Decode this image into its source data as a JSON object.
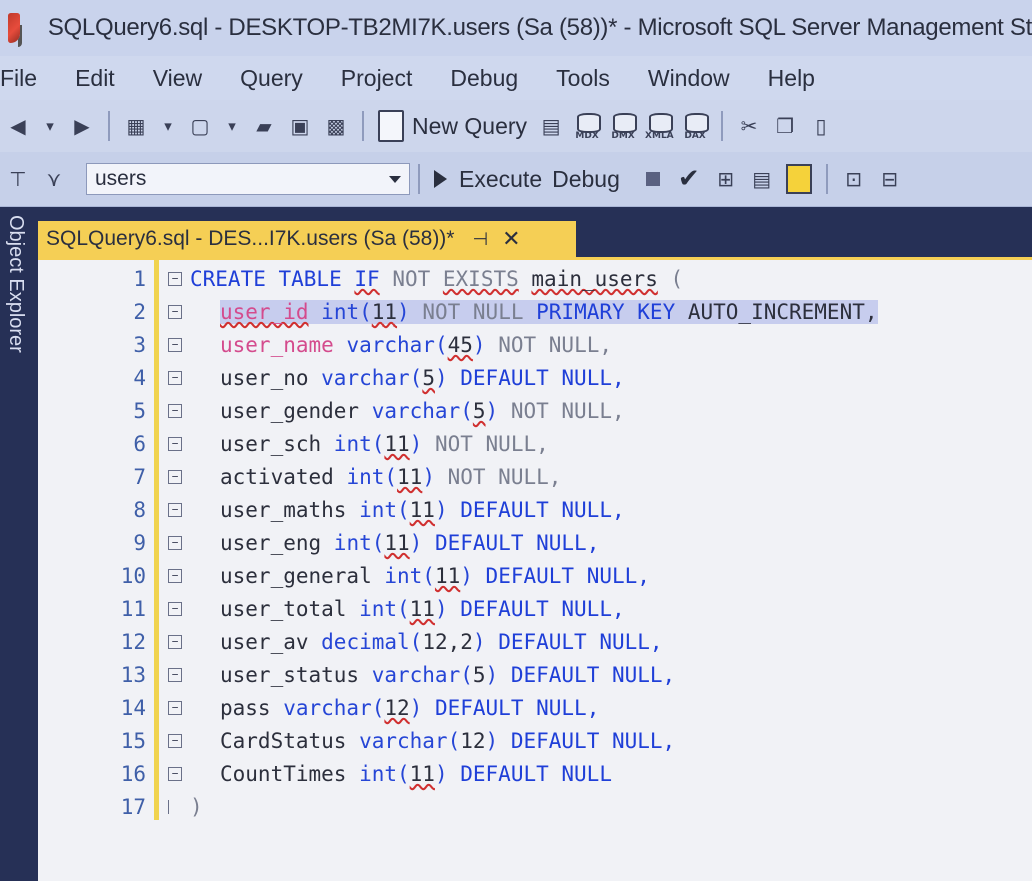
{
  "title_bar": {
    "title": "SQLQuery6.sql - DESKTOP-TB2MI7K.users (Sa (58))* - Microsoft SQL Server Management St"
  },
  "menu": [
    "File",
    "Edit",
    "View",
    "Query",
    "Project",
    "Debug",
    "Tools",
    "Window",
    "Help"
  ],
  "toolbar": {
    "new_query_label": "New Query",
    "db_icon_tags": [
      "MDX",
      "DMX",
      "XMLA",
      "DAX"
    ]
  },
  "toolbar2": {
    "database": "users",
    "execute_label": "Execute",
    "debug_label": "Debug"
  },
  "side_panel": {
    "label": "Object Explorer"
  },
  "document_tab": {
    "title": "SQLQuery6.sql - DES...I7K.users (Sa (58))*"
  },
  "editor": {
    "line_numbers": [
      "1",
      "2",
      "3",
      "4",
      "5",
      "6",
      "7",
      "8",
      "9",
      "10",
      "11",
      "12",
      "13",
      "14",
      "15",
      "16",
      "17"
    ],
    "lines": [
      [
        {
          "t": "CREATE TABLE ",
          "c": "kw"
        },
        {
          "t": "IF",
          "c": "kw squig"
        },
        {
          "t": " NOT ",
          "c": "gr"
        },
        {
          "t": "EXISTS",
          "c": "gr squig"
        },
        {
          "t": " ",
          "c": "id"
        },
        {
          "t": "main_users",
          "c": "id squig"
        },
        {
          "t": " (",
          "c": "gr"
        }
      ],
      [
        {
          "t": "user_id",
          "c": "pink squig"
        },
        {
          "t": " ",
          "c": "id"
        },
        {
          "t": "int(",
          "c": "tp"
        },
        {
          "t": "11",
          "c": "id squig"
        },
        {
          "t": ")",
          "c": "tp"
        },
        {
          "t": " NOT NULL ",
          "c": "gr"
        },
        {
          "t": "PRIMARY KEY",
          "c": "pk"
        },
        {
          "t": " AUTO_INCREMENT,",
          "c": "id"
        }
      ],
      [
        {
          "t": "user_name",
          "c": "pink"
        },
        {
          "t": " ",
          "c": "id"
        },
        {
          "t": "varchar(",
          "c": "tp"
        },
        {
          "t": "45",
          "c": "id squig"
        },
        {
          "t": ")",
          "c": "tp"
        },
        {
          "t": " NOT NULL,",
          "c": "gr"
        }
      ],
      [
        {
          "t": "user_no ",
          "c": "id"
        },
        {
          "t": "varchar(",
          "c": "tp"
        },
        {
          "t": "5",
          "c": "id squig"
        },
        {
          "t": ")",
          "c": "tp"
        },
        {
          "t": " DEFAULT NULL,",
          "c": "kw"
        }
      ],
      [
        {
          "t": "user_gender ",
          "c": "id"
        },
        {
          "t": "varchar(",
          "c": "tp"
        },
        {
          "t": "5",
          "c": "id squig"
        },
        {
          "t": ")",
          "c": "tp"
        },
        {
          "t": " NOT NULL,",
          "c": "gr"
        }
      ],
      [
        {
          "t": "user_sch ",
          "c": "id"
        },
        {
          "t": "int(",
          "c": "tp"
        },
        {
          "t": "11",
          "c": "id squig"
        },
        {
          "t": ")",
          "c": "tp"
        },
        {
          "t": " NOT NULL,",
          "c": "gr"
        }
      ],
      [
        {
          "t": "activated ",
          "c": "id"
        },
        {
          "t": "int(",
          "c": "tp"
        },
        {
          "t": "11",
          "c": "id squig"
        },
        {
          "t": ")",
          "c": "tp"
        },
        {
          "t": " NOT NULL,",
          "c": "gr"
        }
      ],
      [
        {
          "t": "user_maths ",
          "c": "id"
        },
        {
          "t": "int(",
          "c": "tp"
        },
        {
          "t": "11",
          "c": "id squig"
        },
        {
          "t": ")",
          "c": "tp"
        },
        {
          "t": " DEFAULT NULL,",
          "c": "kw"
        }
      ],
      [
        {
          "t": "user_eng ",
          "c": "id"
        },
        {
          "t": "int(",
          "c": "tp"
        },
        {
          "t": "11",
          "c": "id squig"
        },
        {
          "t": ")",
          "c": "tp"
        },
        {
          "t": " DEFAULT NULL,",
          "c": "kw"
        }
      ],
      [
        {
          "t": "user_general ",
          "c": "id"
        },
        {
          "t": "int(",
          "c": "tp"
        },
        {
          "t": "11",
          "c": "id squig"
        },
        {
          "t": ")",
          "c": "tp"
        },
        {
          "t": " DEFAULT NULL,",
          "c": "kw"
        }
      ],
      [
        {
          "t": "user_total ",
          "c": "id"
        },
        {
          "t": "int(",
          "c": "tp"
        },
        {
          "t": "11",
          "c": "id squig"
        },
        {
          "t": ")",
          "c": "tp"
        },
        {
          "t": " DEFAULT NULL,",
          "c": "kw"
        }
      ],
      [
        {
          "t": "user_av ",
          "c": "id"
        },
        {
          "t": "decimal(",
          "c": "tp"
        },
        {
          "t": "12,2",
          "c": "id"
        },
        {
          "t": ")",
          "c": "tp"
        },
        {
          "t": " DEFAULT NULL,",
          "c": "kw"
        }
      ],
      [
        {
          "t": "user_status ",
          "c": "id"
        },
        {
          "t": "varchar(",
          "c": "tp"
        },
        {
          "t": "5",
          "c": "id"
        },
        {
          "t": ")",
          "c": "tp"
        },
        {
          "t": " DEFAULT NULL,",
          "c": "kw"
        }
      ],
      [
        {
          "t": "pass ",
          "c": "id"
        },
        {
          "t": "varchar(",
          "c": "tp"
        },
        {
          "t": "12",
          "c": "id squig"
        },
        {
          "t": ")",
          "c": "tp"
        },
        {
          "t": " DEFAULT NULL,",
          "c": "kw"
        }
      ],
      [
        {
          "t": "CardStatus ",
          "c": "id"
        },
        {
          "t": "varchar(",
          "c": "tp"
        },
        {
          "t": "12",
          "c": "id"
        },
        {
          "t": ")",
          "c": "tp"
        },
        {
          "t": " DEFAULT NULL,",
          "c": "kw"
        }
      ],
      [
        {
          "t": "CountTimes ",
          "c": "id"
        },
        {
          "t": "int(",
          "c": "tp"
        },
        {
          "t": "11",
          "c": "id squig"
        },
        {
          "t": ")",
          "c": "tp"
        },
        {
          "t": " DEFAULT NULL",
          "c": "kw"
        }
      ],
      [
        {
          "t": ")",
          "c": "gr"
        }
      ]
    ]
  }
}
